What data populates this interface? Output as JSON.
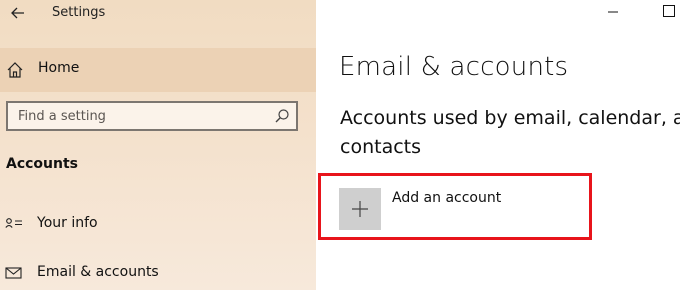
{
  "window": {
    "app_title": "Settings",
    "icons": {
      "back": "back-arrow-icon",
      "minimize": "minimize-icon",
      "maximize": "maximize-icon"
    }
  },
  "sidebar": {
    "home": {
      "label": "Home",
      "icon": "home-icon"
    },
    "search": {
      "placeholder": "Find a setting",
      "value": "",
      "icon": "search-icon"
    },
    "section_header": "Accounts",
    "items": [
      {
        "label": "Your info",
        "icon": "person-card-icon"
      },
      {
        "label": "Email & accounts",
        "icon": "mail-icon"
      }
    ]
  },
  "main": {
    "title": "Email & accounts",
    "subtitle": "Accounts used by email, calendar, and contacts",
    "add_account": {
      "label": "Add an account",
      "icon": "plus-icon"
    }
  },
  "colors": {
    "sidebar_bg": "#f1dcc2",
    "highlight_border": "#e8141b",
    "tile_bg": "#cfcfcf"
  }
}
